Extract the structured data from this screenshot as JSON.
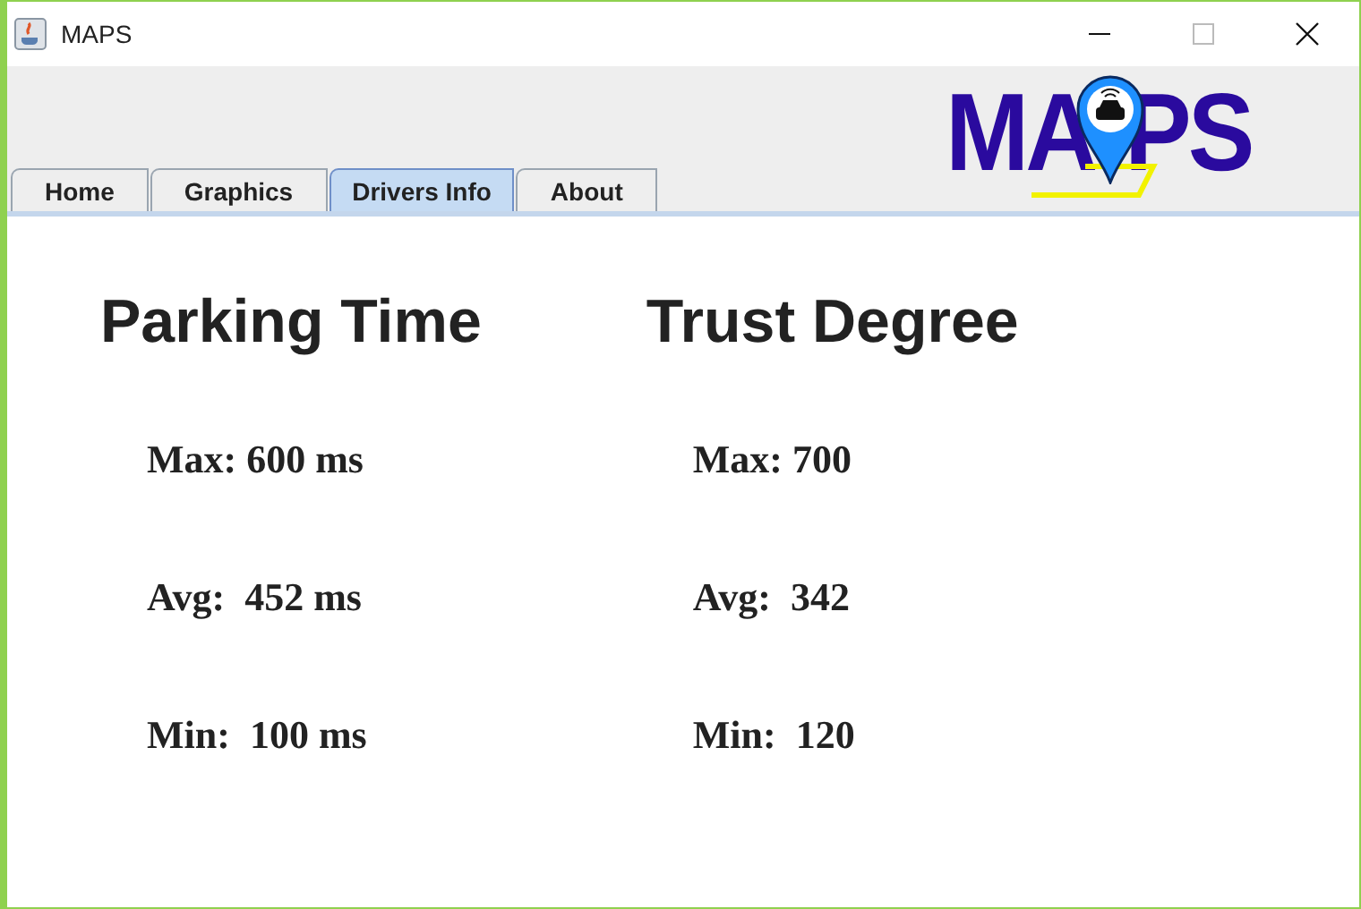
{
  "window": {
    "title": "MAPS"
  },
  "tabs": [
    {
      "label": "Home",
      "selected": false
    },
    {
      "label": "Graphics",
      "selected": false
    },
    {
      "label": "Drivers Info",
      "selected": true
    },
    {
      "label": "About",
      "selected": false
    }
  ],
  "logo": {
    "left": "MA",
    "right": "PS"
  },
  "sections": [
    {
      "title": "Parking Time",
      "stats": [
        "Max: 600 ms",
        "Avg:  452 ms",
        "Min:  100 ms"
      ]
    },
    {
      "title": "Trust Degree",
      "stats": [
        "Max: 700",
        "Avg:  342",
        "Min:  120"
      ]
    }
  ]
}
